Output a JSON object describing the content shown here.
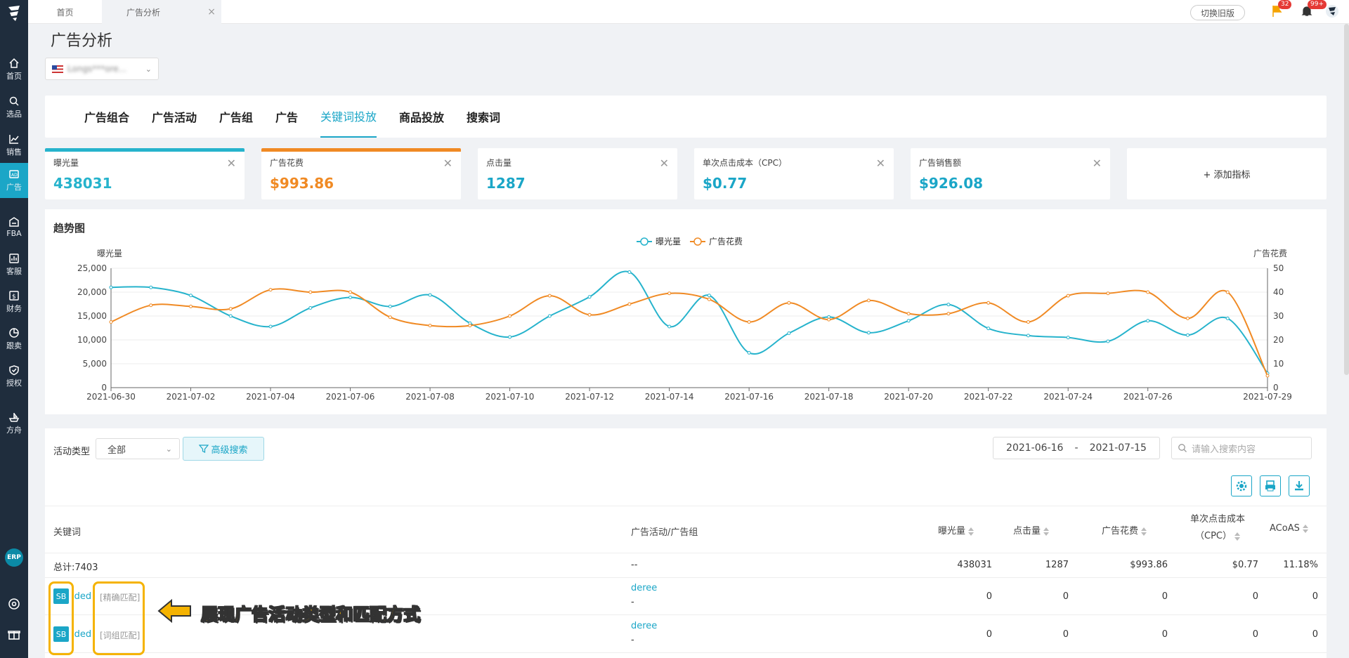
{
  "sidebar": {
    "items": [
      {
        "label": "首页",
        "icon": "home-icon"
      },
      {
        "label": "选品",
        "icon": "search-icon"
      },
      {
        "label": "销售",
        "icon": "trend-icon"
      },
      {
        "label": "广告",
        "icon": "ad-icon"
      },
      {
        "label": "FBA",
        "icon": "warehouse-icon"
      },
      {
        "label": "客服",
        "icon": "chart-icon"
      },
      {
        "label": "财务",
        "icon": "dollar-icon"
      },
      {
        "label": "跟卖",
        "icon": "pie-icon"
      },
      {
        "label": "授权",
        "icon": "shield-icon"
      },
      {
        "label": "方舟",
        "icon": "ark-icon"
      }
    ],
    "erp_label": "ERP"
  },
  "tabs": {
    "home": "首页",
    "current": "广告分析",
    "close": "×"
  },
  "topbar": {
    "old_version": "切换旧版",
    "flag_badge": "32",
    "bell_badge": "99+"
  },
  "page": {
    "title": "广告分析",
    "store_name": "Longs***ore..."
  },
  "nav_tabs": [
    "广告组合",
    "广告活动",
    "广告组",
    "广告",
    "关键词投放",
    "商品投放",
    "搜索词"
  ],
  "metrics": [
    {
      "label": "曝光量",
      "value": "438031",
      "color": "#26b3cc"
    },
    {
      "label": "广告花费",
      "value": "$993.86",
      "color": "#f08a24"
    },
    {
      "label": "点击量",
      "value": "1287",
      "color": "#1ba6c7"
    },
    {
      "label": "单次点击成本（CPC）",
      "value": "$0.77",
      "color": "#1ba6c7"
    },
    {
      "label": "广告销售额",
      "value": "$926.08",
      "color": "#1ba6c7"
    }
  ],
  "add_metric": "+ 添加指标",
  "chart_title": "趋势图",
  "chart_data": {
    "type": "line",
    "x": [
      "2021-06-30",
      "2021-07-01",
      "2021-07-02",
      "2021-07-03",
      "2021-07-04",
      "2021-07-05",
      "2021-07-06",
      "2021-07-07",
      "2021-07-08",
      "2021-07-09",
      "2021-07-10",
      "2021-07-11",
      "2021-07-12",
      "2021-07-13",
      "2021-07-14",
      "2021-07-15",
      "2021-07-16",
      "2021-07-17",
      "2021-07-18",
      "2021-07-19",
      "2021-07-20",
      "2021-07-21",
      "2021-07-22",
      "2021-07-23",
      "2021-07-24",
      "2021-07-25",
      "2021-07-26",
      "2021-07-27",
      "2021-07-28",
      "2021-07-29"
    ],
    "x_tick_labels": [
      "2021-06-30",
      "2021-07-02",
      "2021-07-04",
      "2021-07-06",
      "2021-07-08",
      "2021-07-10",
      "2021-07-12",
      "2021-07-14",
      "2021-07-16",
      "2021-07-18",
      "2021-07-20",
      "2021-07-22",
      "2021-07-24",
      "2021-07-26",
      "2021-07-29"
    ],
    "series": [
      {
        "name": "曝光量",
        "axis": "left",
        "color": "#26b3cc",
        "values": [
          21000,
          21000,
          19300,
          15000,
          12800,
          16700,
          18900,
          17000,
          19400,
          13500,
          10600,
          15000,
          19000,
          24200,
          12800,
          19300,
          7300,
          11400,
          14800,
          11500,
          14000,
          17400,
          12400,
          10900,
          10500,
          9700,
          14000,
          11000,
          14500,
          3000
        ]
      },
      {
        "name": "广告花费",
        "axis": "right",
        "color": "#f08a24",
        "values": [
          27.5,
          34.5,
          34,
          33,
          41,
          40,
          40,
          29.5,
          26,
          26,
          30,
          38.5,
          30.5,
          35,
          39.5,
          37,
          27.5,
          35.5,
          28.5,
          36.5,
          31,
          31,
          35.5,
          27.5,
          38.5,
          39.5,
          40,
          29,
          40,
          5
        ]
      }
    ],
    "y_left": {
      "label": "曝光量",
      "ticks": [
        "0",
        "5,000",
        "10,000",
        "15,000",
        "20,000",
        "25,000"
      ],
      "range": [
        0,
        25000
      ]
    },
    "y_right": {
      "label": "广告花费",
      "ticks": [
        "0",
        "10",
        "20",
        "30",
        "40",
        "50"
      ],
      "range": [
        0,
        50
      ]
    },
    "legend": "top-center"
  },
  "filters": {
    "activity_type_label": "活动类型",
    "activity_type_value": "全部",
    "advanced_search": "高级搜索",
    "date_start": "2021-06-16",
    "date_sep": "-",
    "date_end": "2021-07-15",
    "search_placeholder": "请输入搜索内容"
  },
  "table": {
    "headers": {
      "keyword": "关键词",
      "campaign": "广告活动/广告组",
      "impr": "曝光量",
      "clicks": "点击量",
      "spend": "广告花费",
      "cpc": "单次点击成本",
      "cpc2": "（CPC）",
      "acos": "ACoAS"
    },
    "total": {
      "keyword": "总计:7403",
      "campaign": "--",
      "impr": "438031",
      "clicks": "1287",
      "spend": "$993.86",
      "cpc": "$0.77",
      "acos": "11.18%"
    },
    "rows": [
      {
        "tag": "SB",
        "keyword": "'ded",
        "match": "[精确匹配]",
        "campaign": "deree",
        "group": "-",
        "impr": "0",
        "clicks": "0",
        "spend": "0",
        "cpc": "0",
        "acos": "0"
      },
      {
        "tag": "SB",
        "keyword": "'ded",
        "match": "[词组匹配]",
        "campaign": "deree",
        "group": "-",
        "impr": "0",
        "clicks": "0",
        "spend": "0",
        "cpc": "0",
        "acos": "0"
      }
    ]
  },
  "annotation": "展现广告活动类型和匹配方式"
}
